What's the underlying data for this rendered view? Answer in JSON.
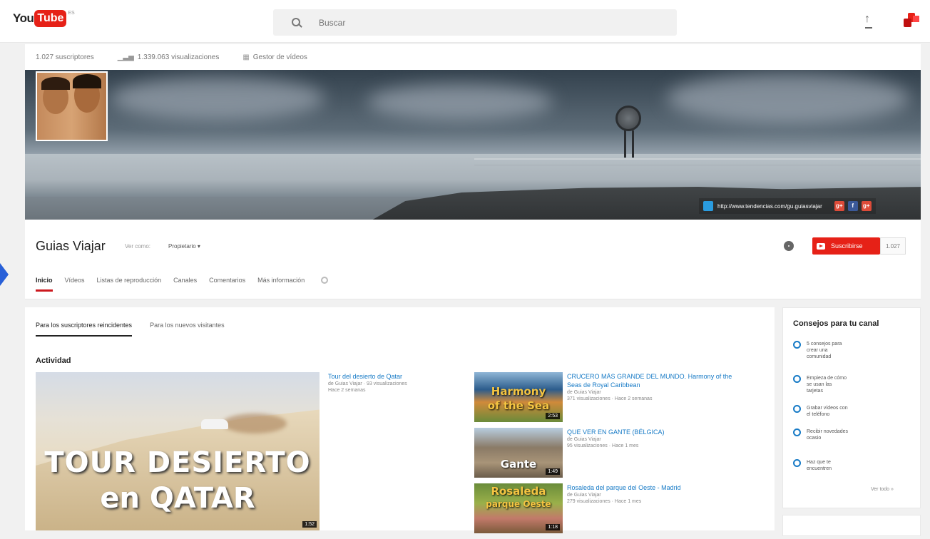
{
  "topbar": {
    "logo_you": "You",
    "logo_tube": "Tube",
    "logo_country": "ES",
    "search_placeholder": "Buscar"
  },
  "channel_stats": {
    "subscribers": "1.027 suscriptores",
    "views": "1.339.063 visualizaciones",
    "video_manager": "Gestor de vídeos"
  },
  "banner": {
    "website_url": "http://www.tendencias.com/gu.guiasviajar",
    "social_links": [
      "g+",
      "f",
      "g+"
    ]
  },
  "channel": {
    "name": "Guias Viajar",
    "view_as_label": "Ver como:",
    "view_as_value": "Propietario ▾",
    "subscribe_label": "Suscribirse",
    "subscriber_count": "1.027"
  },
  "tabs": [
    {
      "label": "Inicio",
      "active": true
    },
    {
      "label": "Vídeos",
      "active": false
    },
    {
      "label": "Listas de reproducción",
      "active": false
    },
    {
      "label": "Canales",
      "active": false
    },
    {
      "label": "Comentarios",
      "active": false
    },
    {
      "label": "Más información",
      "active": false
    }
  ],
  "subtabs": [
    {
      "label": "Para los suscriptores reincidentes",
      "active": true
    },
    {
      "label": "Para los nuevos visitantes",
      "active": false
    }
  ],
  "activity": {
    "title": "Actividad",
    "featured": {
      "thumb_line1": "TOUR DESIERTO",
      "thumb_line2": "en QATAR",
      "duration": "1:52",
      "title": "Tour del desierto de Qatar",
      "meta_line1": "de Guias Viajar · 93 visualizaciones",
      "meta_line2": "Hace 2 semanas"
    },
    "videos": [
      {
        "thumb_label_1": "Harmony",
        "thumb_label_2": "of the Sea",
        "duration": "2:53",
        "title": "CRUCERO MÁS GRANDE DEL MUNDO. Harmony of the Seas de Royal Caribbean",
        "channel": "de Guias Viajar",
        "meta": "371 visualizaciones · Hace 2 semanas"
      },
      {
        "thumb_label_1": "Gante",
        "thumb_label_2": "",
        "duration": "1:49",
        "title": "QUE VER EN GANTE (BÉLGICA)",
        "channel": "de Guias Viajar",
        "meta": "95 visualizaciones · Hace 1 mes"
      },
      {
        "thumb_label_1": "Rosaleda",
        "thumb_label_2": "parque Oeste",
        "duration": "1:18",
        "title": "Rosaleda del parque del Oeste - Madrid",
        "channel": "de Guias Viajar",
        "meta": "279 visualizaciones · Hace 1 mes"
      }
    ]
  },
  "sidebar": {
    "title": "Consejos para tu canal",
    "tips": [
      "5 consejos para crear una comunidad",
      "Empieza de cómo se usan las tarjetas",
      "Grabar vídeos con el teléfono",
      "Recibir novedades ocasio",
      "Haz que te encuentren"
    ],
    "see_all": "Ver todo »"
  }
}
